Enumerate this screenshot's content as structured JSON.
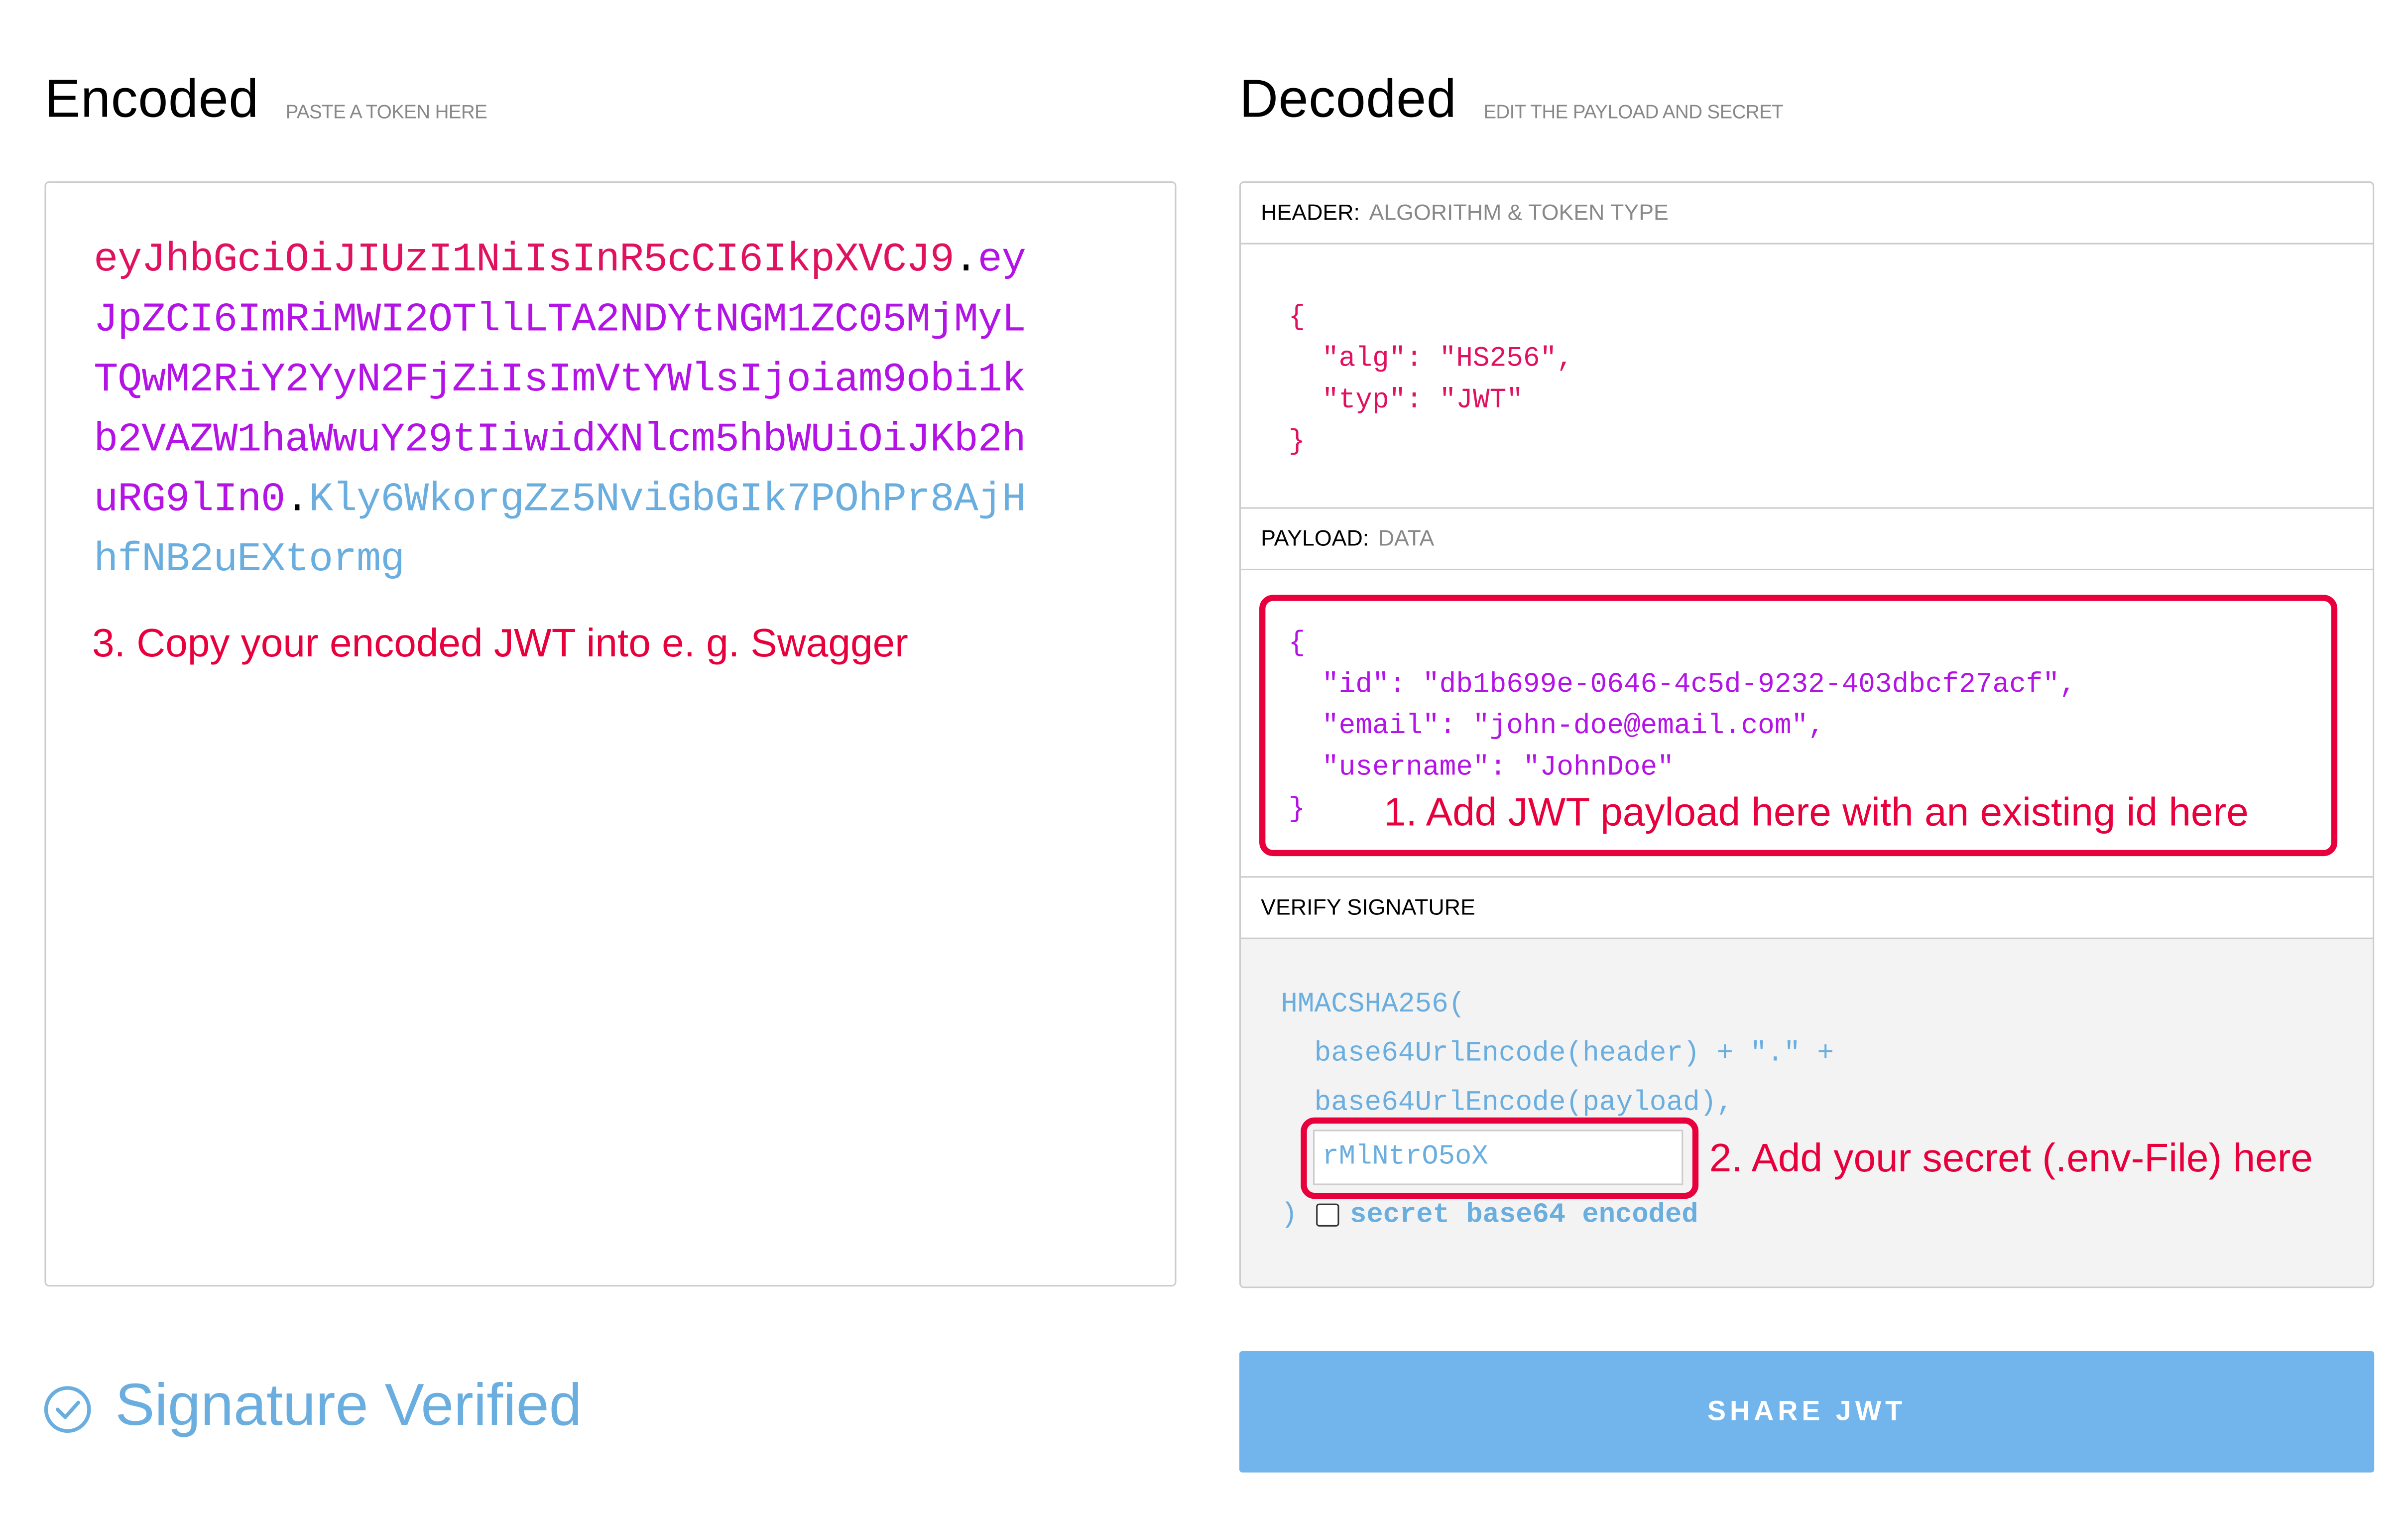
{
  "encoded": {
    "title": "Encoded",
    "subtitle": "PASTE A TOKEN HERE",
    "token_header": "eyJhbGciOiJIUzI1NiIsInR5cCI6IkpXVCJ9",
    "token_payload": "eyJpZCI6ImRiMWI2OTllLTA2NDYtNGM1ZC05MjMyLTQwM2RiY2YyN2FjZiIsImVtYWlsIjoiam9obi1kb2VAZW1haWwuY29tIiwidXNlcm5hbWUiOiJKb2huRG9lIn0",
    "token_signature": "Kly6WkorgZz5NviGbGIk7POhPr8AjHhfNB2uEXtormg",
    "dot": "."
  },
  "decoded": {
    "title": "Decoded",
    "subtitle": "EDIT THE PAYLOAD AND SECRET",
    "header_section": {
      "title": "HEADER:",
      "desc": "ALGORITHM & TOKEN TYPE",
      "json": "{\n  \"alg\": \"HS256\",\n  \"typ\": \"JWT\"\n}"
    },
    "payload_section": {
      "title": "PAYLOAD:",
      "desc": "DATA",
      "json": "{\n  \"id\": \"db1b699e-0646-4c5d-9232-403dbcf27acf\",\n  \"email\": \"john-doe@email.com\",\n  \"username\": \"JohnDoe\"\n}"
    },
    "verify_section": {
      "title": "VERIFY SIGNATURE",
      "line1": "HMACSHA256(",
      "line2": "  base64UrlEncode(header) + \".\" +",
      "line3": "  base64UrlEncode(payload),",
      "secret_value": "rMlNtrO5oX",
      "close_paren": ")",
      "checkbox_label": "secret base64 encoded",
      "checkbox_checked": false
    }
  },
  "annotations": {
    "step1": "1. Add JWT payload here with an existing id here",
    "step2": "2. Add your secret (.env-File) here",
    "step3": "3. Copy your encoded JWT into e. g. Swagger"
  },
  "status": {
    "text": "Signature Verified"
  },
  "share_button": {
    "label": "SHARE JWT"
  },
  "colors": {
    "header": "#e0115f",
    "payload": "#b413e6",
    "signature": "#6aaedf",
    "annotation": "#e8003d",
    "button": "#71b5ec"
  }
}
